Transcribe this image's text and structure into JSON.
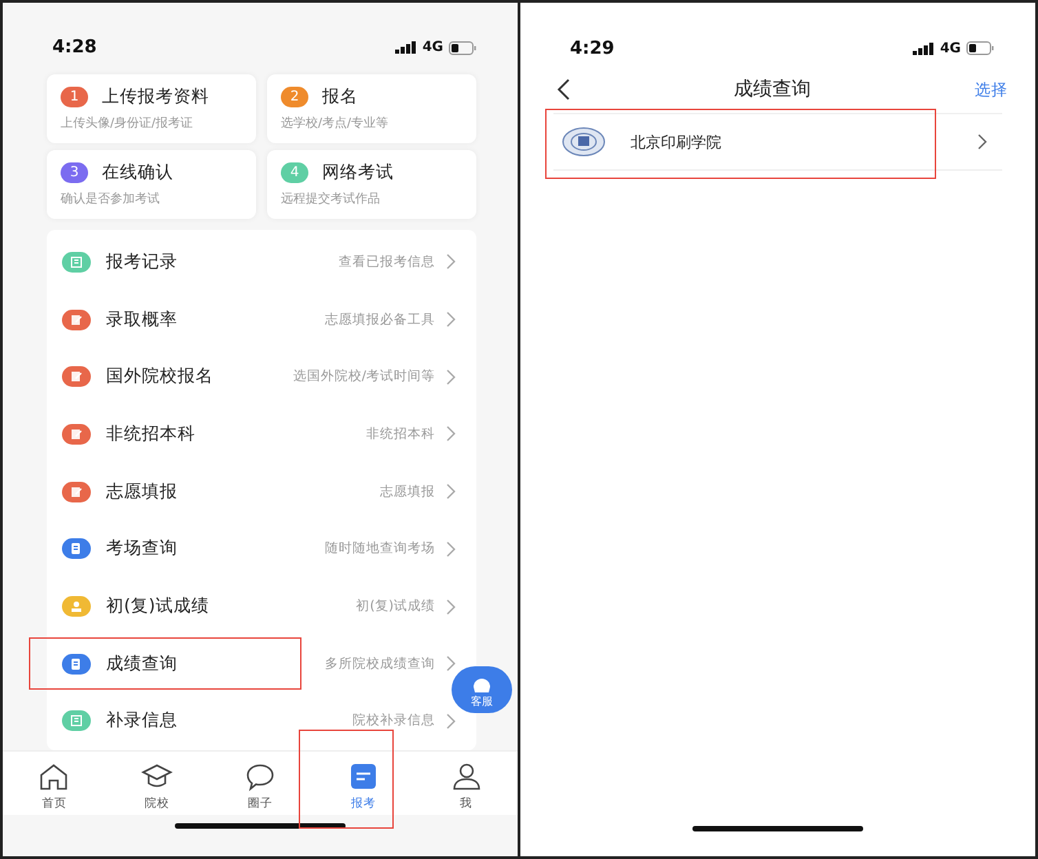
{
  "left_screen": {
    "status_bar": {
      "time": "4:28",
      "network": "4G"
    },
    "steps": [
      {
        "number": "1",
        "title": "上传报考资料",
        "subtitle": "上传头像/身份证/报考证",
        "color": "#e8674a"
      },
      {
        "number": "2",
        "title": "报名",
        "subtitle": "选学校/考点/专业等",
        "color": "#ef8b2c"
      },
      {
        "number": "3",
        "title": "在线确认",
        "subtitle": "确认是否参加考试",
        "color": "#7b6cf0"
      },
      {
        "number": "4",
        "title": "网络考试",
        "subtitle": "远程提交考试作品",
        "color": "#5fcfa4"
      }
    ],
    "menu": [
      {
        "title": "报考记录",
        "hint": "查看已报考信息",
        "kind": "list",
        "color": "#5fcfa4",
        "highlighted": false
      },
      {
        "title": "录取概率",
        "hint": "志愿填报必备工具",
        "kind": "edit",
        "color": "#e8674a",
        "highlighted": false
      },
      {
        "title": "国外院校报名",
        "hint": "选国外院校/考试时间等",
        "kind": "edit",
        "color": "#e8674a",
        "highlighted": false
      },
      {
        "title": "非统招本科",
        "hint": "非统招本科",
        "kind": "edit",
        "color": "#e8674a",
        "highlighted": false
      },
      {
        "title": "志愿填报",
        "hint": "志愿填报",
        "kind": "edit",
        "color": "#e8674a",
        "highlighted": false
      },
      {
        "title": "考场查询",
        "hint": "随时随地查询考场",
        "kind": "doc",
        "color": "#3d7de8",
        "highlighted": false
      },
      {
        "title": "初(复)试成绩",
        "hint": "初(复)试成绩",
        "kind": "badge",
        "color": "#f0b934",
        "highlighted": false
      },
      {
        "title": "成绩查询",
        "hint": "多所院校成绩查询",
        "kind": "doc",
        "color": "#3d7de8",
        "highlighted": true
      },
      {
        "title": "补录信息",
        "hint": "院校补录信息",
        "kind": "list",
        "color": "#5fcfa4",
        "highlighted": false
      }
    ],
    "support_button": {
      "label": "客服"
    },
    "tabs": [
      {
        "label": "首页",
        "kind": "home",
        "selected": false,
        "highlighted": false
      },
      {
        "label": "院校",
        "kind": "school",
        "selected": false,
        "highlighted": false
      },
      {
        "label": "圈子",
        "kind": "chat",
        "selected": false,
        "highlighted": false
      },
      {
        "label": "报考",
        "kind": "apply",
        "selected": true,
        "highlighted": true
      },
      {
        "label": "我",
        "kind": "me",
        "selected": false,
        "highlighted": false
      }
    ]
  },
  "right_screen": {
    "status_bar": {
      "time": "4:29",
      "network": "4G"
    },
    "nav": {
      "title": "成绩查询",
      "action": "选择"
    },
    "schools": [
      {
        "name": "北京印刷学院",
        "highlighted": true
      }
    ]
  }
}
